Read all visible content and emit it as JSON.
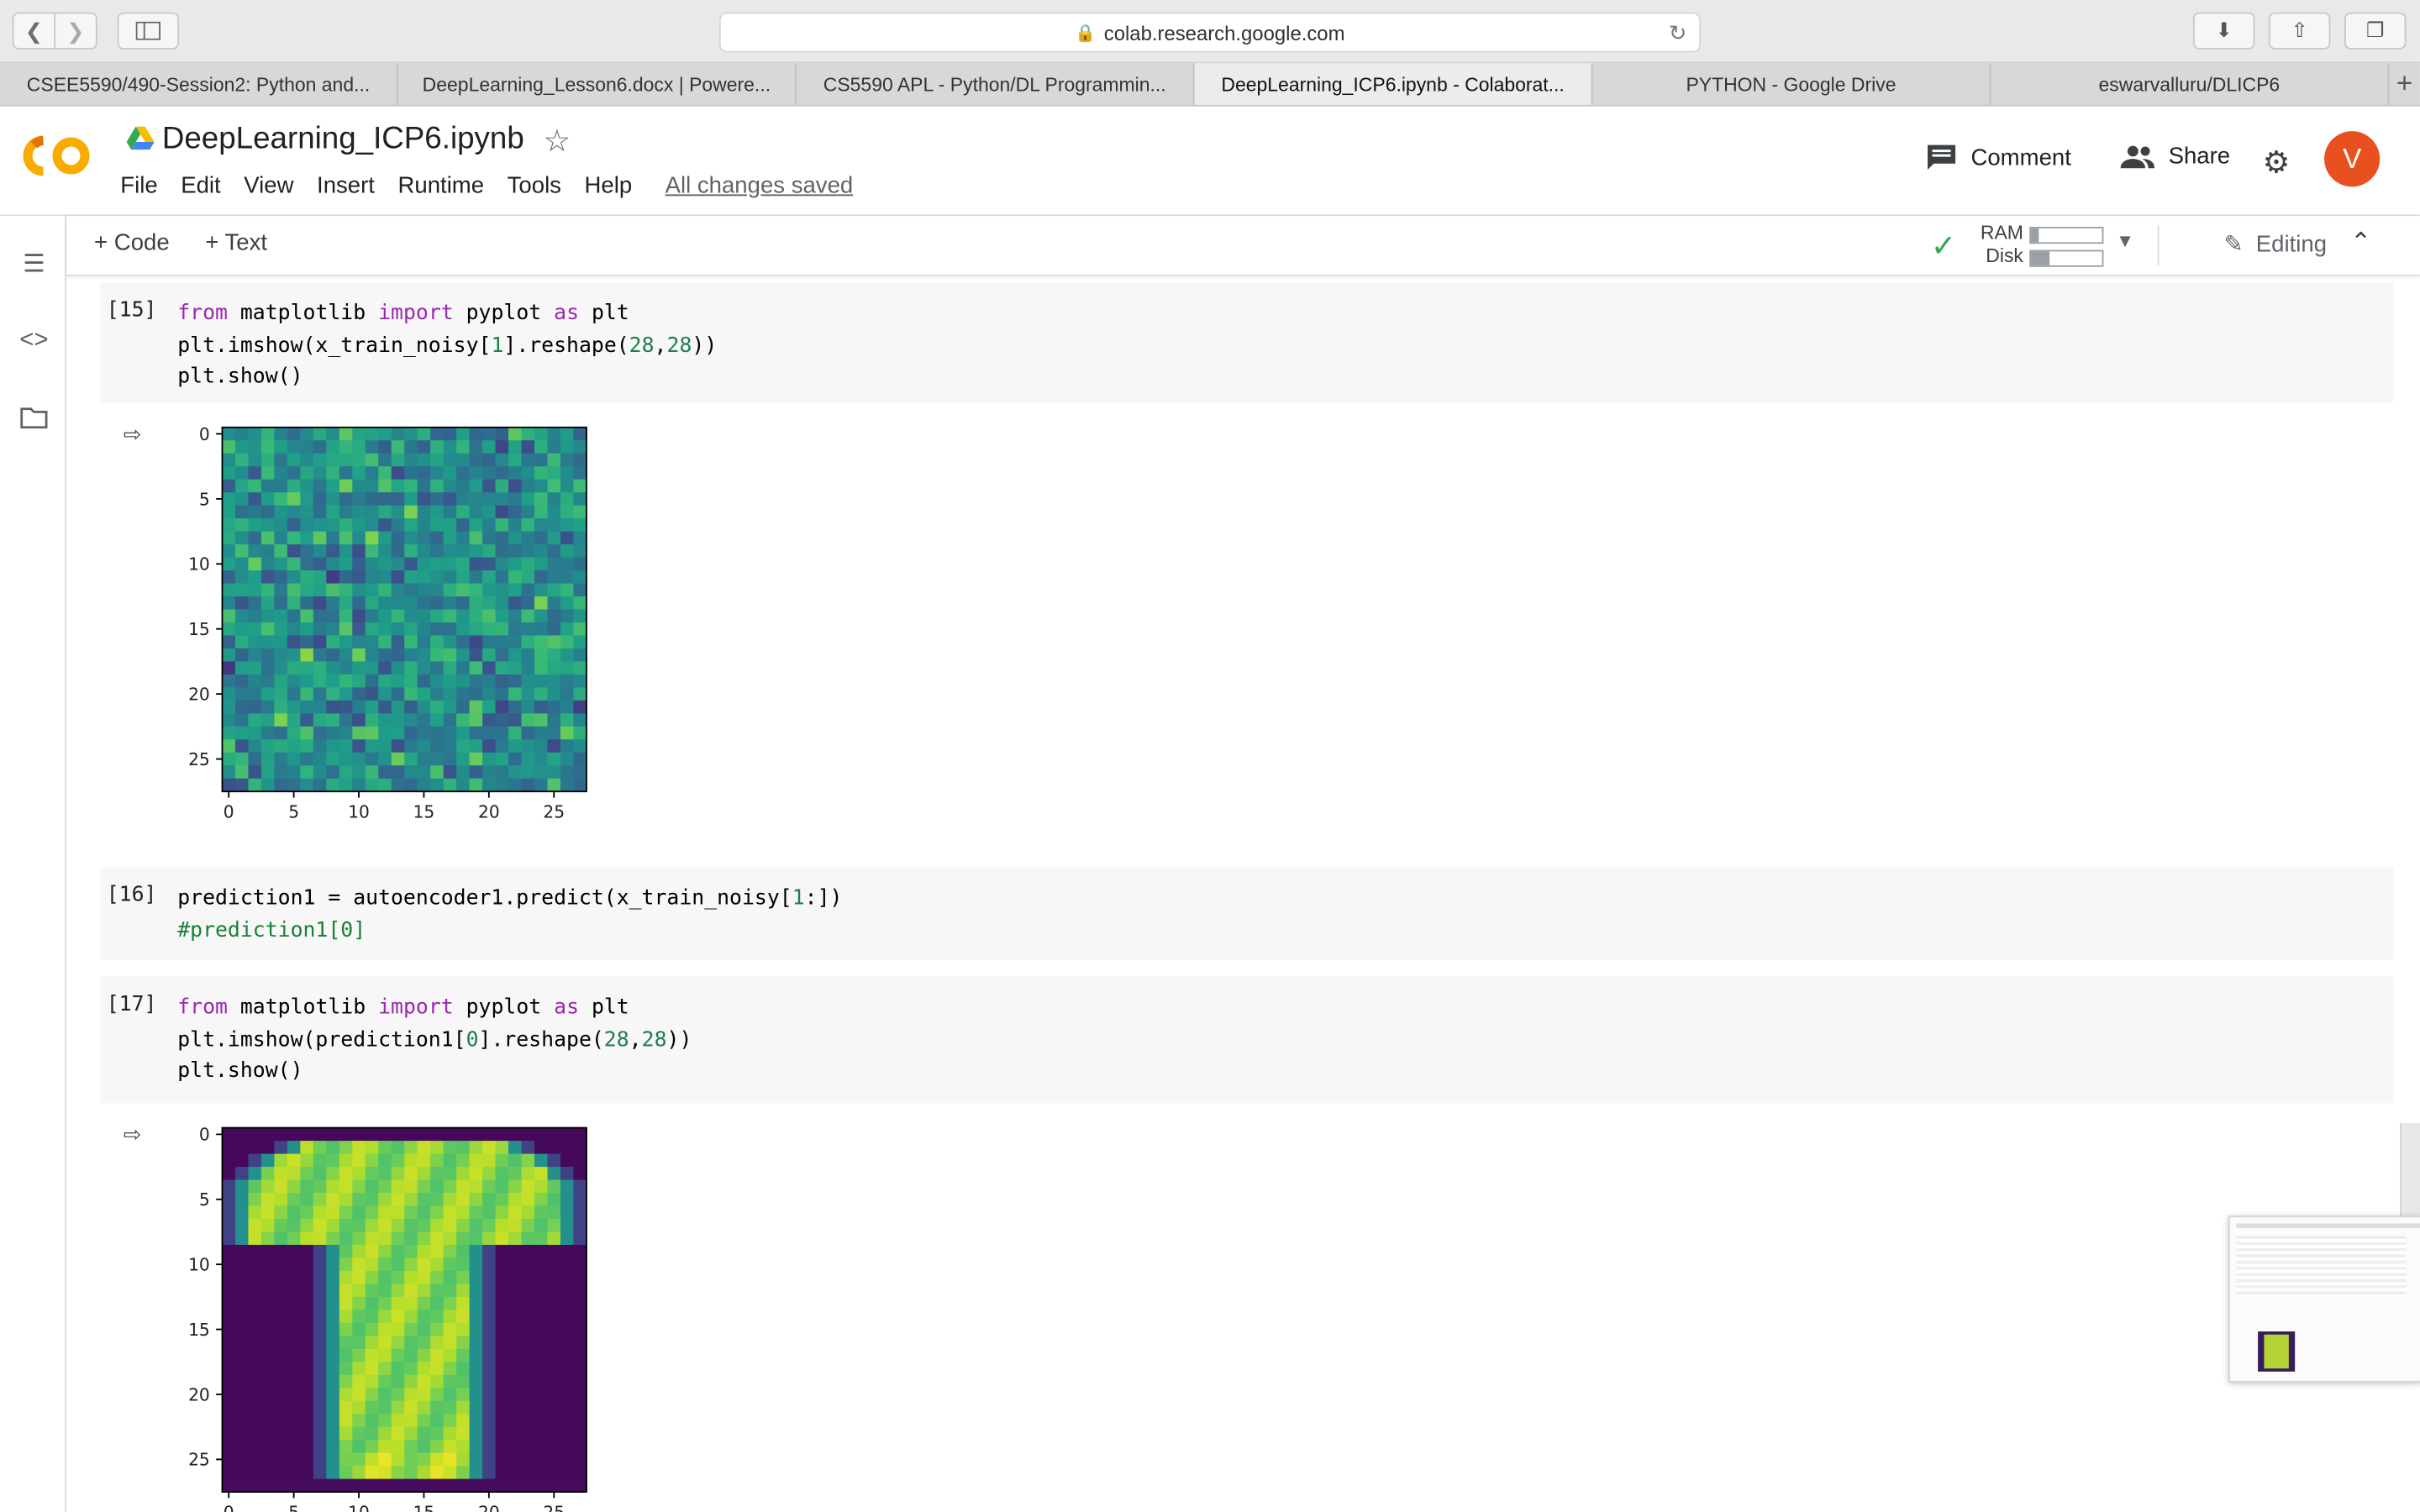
{
  "browser": {
    "url": "colab.research.google.com",
    "tabs": [
      {
        "label": "CSEE5590/490-Session2: Python and..."
      },
      {
        "label": "DeepLearning_Lesson6.docx | Powere..."
      },
      {
        "label": "CS5590 APL - Python/DL Programmin..."
      },
      {
        "label": "DeepLearning_ICP6.ipynb - Colaborat..."
      },
      {
        "label": "PYTHON - Google Drive"
      },
      {
        "label": "eswarvalluru/DLICP6"
      }
    ],
    "active_tab": 3
  },
  "colab": {
    "title": "DeepLearning_ICP6.ipynb",
    "menu": [
      "File",
      "Edit",
      "View",
      "Insert",
      "Runtime",
      "Tools",
      "Help"
    ],
    "save_status": "All changes saved",
    "comment_label": "Comment",
    "share_label": "Share",
    "avatar_letter": "V",
    "avatar_color": "#e8511f"
  },
  "toolbar": {
    "code_label": "Code",
    "text_label": "Text",
    "ram_label": "RAM",
    "disk_label": "Disk",
    "ram_fill": 0.1,
    "disk_fill": 0.25,
    "editing_label": "Editing"
  },
  "cells": [
    {
      "exec": "[15]",
      "lines": [
        [
          [
            "kw",
            "from"
          ],
          [
            "t",
            " matplotlib "
          ],
          [
            "kw",
            "import"
          ],
          [
            "t",
            " pyplot "
          ],
          [
            "kw",
            "as"
          ],
          [
            "t",
            " plt"
          ]
        ],
        [
          [
            "t",
            "plt.imshow(x_train_noisy["
          ],
          [
            "num",
            "1"
          ],
          [
            "t",
            "].reshape("
          ],
          [
            "num",
            "28"
          ],
          [
            "t",
            ","
          ],
          [
            "num",
            "28"
          ],
          [
            "t",
            "))"
          ]
        ],
        [
          [
            "t",
            "plt.show()"
          ]
        ]
      ]
    },
    {
      "exec": "[16]",
      "lines": [
        [
          [
            "t",
            "prediction1 = autoencoder1.predict(x_train_noisy["
          ],
          [
            "num",
            "1"
          ],
          [
            "t",
            ":])"
          ]
        ],
        [
          [
            "cm",
            "#prediction1[0]"
          ]
        ]
      ]
    },
    {
      "exec": "[17]",
      "lines": [
        [
          [
            "kw",
            "from"
          ],
          [
            "t",
            " matplotlib "
          ],
          [
            "kw",
            "import"
          ],
          [
            "t",
            " pyplot "
          ],
          [
            "kw",
            "as"
          ],
          [
            "t",
            " plt"
          ]
        ],
        [
          [
            "t",
            "plt.imshow(prediction1["
          ],
          [
            "num",
            "0"
          ],
          [
            "t",
            "].reshape("
          ],
          [
            "num",
            "28"
          ],
          [
            "t",
            ","
          ],
          [
            "num",
            "28"
          ],
          [
            "t",
            "))"
          ]
        ],
        [
          [
            "t",
            "plt.show()"
          ]
        ]
      ]
    }
  ],
  "plots": {
    "ticks": [
      "0",
      "5",
      "10",
      "15",
      "20",
      "25"
    ],
    "cmap": "viridis"
  }
}
